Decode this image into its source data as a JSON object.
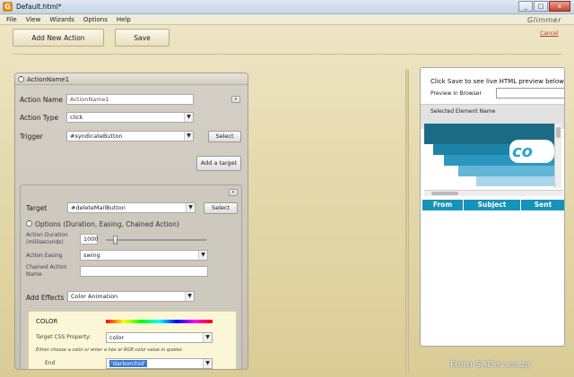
{
  "window": {
    "title": "Default.html*",
    "app_icon": "G",
    "brand": "Glimmer",
    "min": "_",
    "max": "□",
    "close": "x"
  },
  "menu": [
    "File",
    "View",
    "Wizards",
    "Options",
    "Help"
  ],
  "toolbar": {
    "add_action": "Add New Action",
    "save": "Save",
    "cancel": "Cancel"
  },
  "action_panel": {
    "title": "ActionName1",
    "name_label": "Action Name",
    "name_value": "ActionName1",
    "type_label": "Action Type",
    "type_value": "click",
    "trigger_label": "Trigger",
    "trigger_value": "#syndicateButton",
    "select_label": "Select",
    "add_target": "Add a target"
  },
  "target_panel": {
    "target_label": "Target",
    "target_value": "#deleteMailButton",
    "select_label": "Select",
    "options_label": "Options (Duration, Easing, Chained Action)",
    "duration_label": "Action Duration (milliseconds)",
    "duration_value": "1000",
    "slider_level": 0.09,
    "easing_label": "Action Easing",
    "easing_value": "swing",
    "chained_label": "Chained Action Name",
    "chained_value": "",
    "effects_label": "Add Effects",
    "effects_value": "Color Animation"
  },
  "color_section": {
    "title": "COLOR",
    "css_label": "Target CSS Property:",
    "css_value": "color",
    "hint": "Either choose a color or enter a hex or RGB color value in quotes",
    "end_label": "End",
    "end_value": "'darkorchid'"
  },
  "preview": {
    "info": "Click Save to see live HTML preview below",
    "browser_label": "Preview in Browser",
    "selected_label": "Selected Element Name",
    "graphic_text": "co",
    "columns": [
      "From",
      "Subject",
      "Sent"
    ]
  },
  "watermark": "From SADev.co.za",
  "colors": {
    "accent": "#1792b8",
    "link": "#c0392b",
    "panel": "#cdc9bf"
  }
}
